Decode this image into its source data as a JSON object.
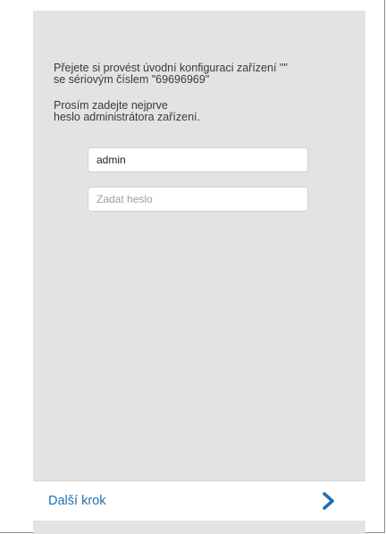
{
  "intro": {
    "line1": "Přejete si provést úvodní konfiguraci zařízení \"\"",
    "line2": "se sériovým číslem \"69696969\""
  },
  "prompt": {
    "line1": "Prosím zadejte nejprve",
    "line2": "heslo administrátora zařízení."
  },
  "username": {
    "value": "admin"
  },
  "password": {
    "value": "",
    "placeholder": "Zadat heslo"
  },
  "footer": {
    "next_label": "Další krok",
    "next_icon": "chevron-right-icon"
  },
  "colors": {
    "panel": "#e2e3e3",
    "accent": "#1f6fb2"
  }
}
